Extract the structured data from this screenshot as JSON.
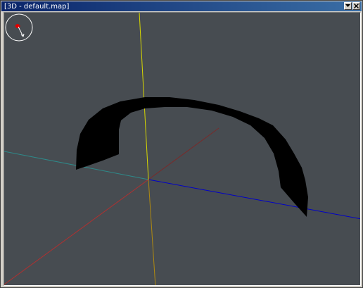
{
  "window": {
    "title": "[3D - default.map]"
  },
  "colors": {
    "titlebar": "#0a246a",
    "viewport_background": "#474c51",
    "axis_x": "#b03030",
    "axis_y": "#0000c8",
    "axis_z": "#d8d800",
    "axis_ref": "#2e8a8a",
    "mesh": "#000000",
    "compass_ring": "#ffffff",
    "compass_center": "#e00000"
  },
  "icons": {
    "minimize": "minimize-icon",
    "close": "close-icon",
    "compass": "compass-icon"
  }
}
